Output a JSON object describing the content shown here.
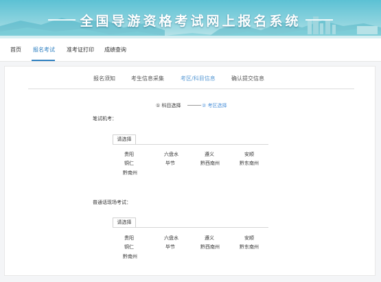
{
  "header": {
    "title": "全国导游资格考试网上报名系统",
    "colors": {
      "banner_top": "#5cc1d4",
      "banner_bottom": "#bfe6ea",
      "accent": "#2d7fc1"
    }
  },
  "nav": {
    "items": [
      {
        "label": "首页"
      },
      {
        "label": "报名考试"
      },
      {
        "label": "准考证打印"
      },
      {
        "label": "成绩查询"
      }
    ],
    "active_index": 1
  },
  "steps": {
    "items": [
      {
        "label": "报名须知"
      },
      {
        "label": "考生信息采集"
      },
      {
        "label": "考区/科目信息"
      },
      {
        "label": "确认提交信息"
      }
    ],
    "active_index": 2
  },
  "substeps": {
    "first": "① 科目选择",
    "second": "② 考区选择",
    "active_index": 1
  },
  "written_exam": {
    "label": "笔试机考：",
    "select_label": "请选择",
    "cities": [
      "贵阳",
      "六盘水",
      "遵义",
      "安顺",
      "铜仁",
      "毕节",
      "黔西南州",
      "黔东南州",
      "黔南州"
    ]
  },
  "oral_exam": {
    "label": "普通话现场考试：",
    "select_label": "请选择",
    "cities": [
      "贵阳",
      "六盘水",
      "遵义",
      "安顺",
      "铜仁",
      "毕节",
      "黔西南州",
      "黔东南州",
      "黔南州"
    ]
  }
}
